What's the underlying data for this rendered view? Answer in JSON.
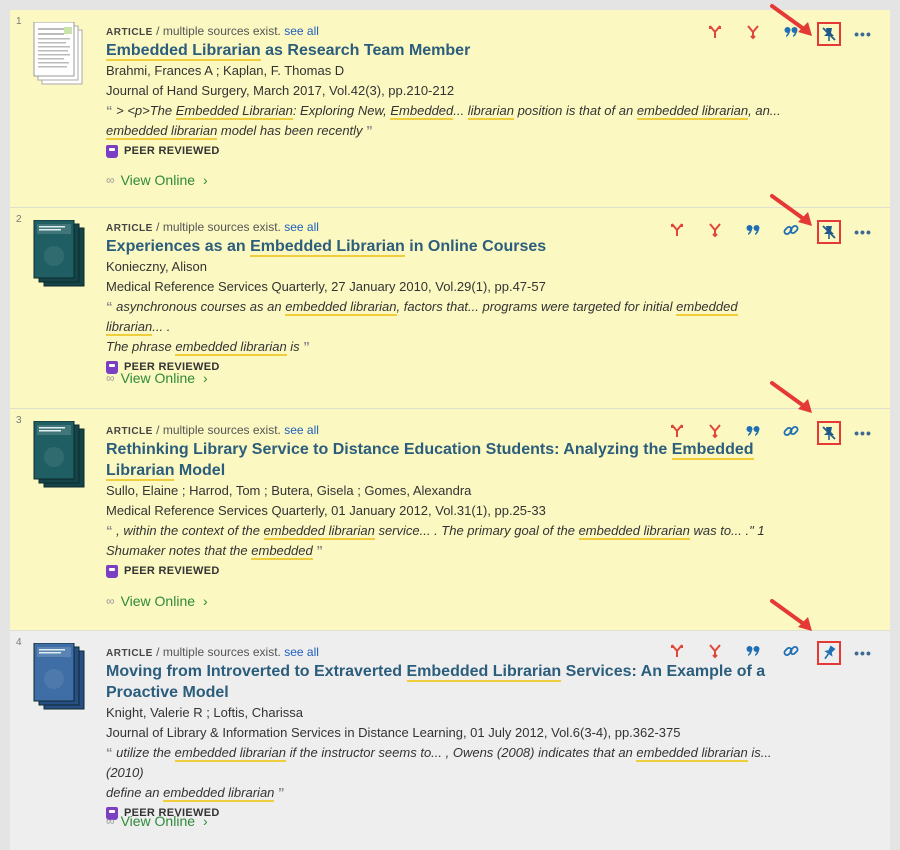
{
  "results": [
    {
      "number": "1",
      "type": "Article",
      "sources_text": " / multiple sources exist.",
      "see_all": "see all",
      "title_parts": [
        {
          "text": "Embedded Librarian",
          "hl": true
        },
        {
          "text": " as Research Team Member",
          "hl": false
        }
      ],
      "authors": "Brahmi, Frances A ; Kaplan, F. Thomas D",
      "source": "Journal of Hand Surgery, March 2017, Vol.42(3), pp.210-212",
      "snippet_lines": [
        [
          {
            "text": " > <p>The ",
            "hl": false
          },
          {
            "text": "Embedded Librarian",
            "hl": true
          },
          {
            "text": ": Exploring New, ",
            "hl": false
          },
          {
            "text": "Embedded",
            "hl": true
          },
          {
            "text": "... ",
            "hl": false
          },
          {
            "text": "librarian",
            "hl": true
          },
          {
            "text": " position is that of an ",
            "hl": false
          },
          {
            "text": "embedded librarian",
            "hl": true
          },
          {
            "text": ", an...",
            "hl": false
          }
        ],
        [
          {
            "text": "embedded librarian",
            "hl": true
          },
          {
            "text": " model has been recently",
            "hl": false
          }
        ]
      ],
      "peer_reviewed": "PEER REVIEWED",
      "view_online": "View Online",
      "pinned": true,
      "actions": [
        "cite-sources",
        "cited-by",
        "citation"
      ],
      "thumb_style": "document"
    },
    {
      "number": "2",
      "type": "Article",
      "sources_text": " / multiple sources exist.",
      "see_all": "see all",
      "title_parts": [
        {
          "text": "Experiences as an ",
          "hl": false
        },
        {
          "text": "Embedded Librarian",
          "hl": true
        },
        {
          "text": " in Online Courses",
          "hl": false
        }
      ],
      "authors": "Konieczny, Alison",
      "source": "Medical Reference Services Quarterly, 27 January 2010, Vol.29(1), pp.47-57",
      "snippet_lines": [
        [
          {
            "text": " asynchronous courses as an ",
            "hl": false
          },
          {
            "text": "embedded librarian",
            "hl": true
          },
          {
            "text": ", factors that... programs were targeted for initial ",
            "hl": false
          },
          {
            "text": "embedded librarian",
            "hl": true
          },
          {
            "text": "... .",
            "hl": false
          }
        ],
        [
          {
            "text": "The phrase ",
            "hl": false
          },
          {
            "text": "embedded librarian",
            "hl": true
          },
          {
            "text": " is",
            "hl": false
          }
        ]
      ],
      "peer_reviewed": "PEER REVIEWED",
      "view_online": "View Online",
      "pinned": true,
      "actions": [
        "cite-sources",
        "cited-by",
        "citation",
        "permalink"
      ],
      "thumb_style": "journal-teal"
    },
    {
      "number": "3",
      "type": "Article",
      "sources_text": " / multiple sources exist.",
      "see_all": "see all",
      "title_parts": [
        {
          "text": "Rethinking Library Service to Distance Education Students: Analyzing the ",
          "hl": false
        },
        {
          "text": "Embedded Librarian",
          "hl": true
        },
        {
          "text": " Model",
          "hl": false
        }
      ],
      "authors": "Sullo, Elaine ; Harrod, Tom ; Butera, Gisela ; Gomes, Alexandra",
      "source": "Medical Reference Services Quarterly, 01 January 2012, Vol.31(1), pp.25-33",
      "snippet_lines": [
        [
          {
            "text": " , within the context of the ",
            "hl": false
          },
          {
            "text": "embedded librarian",
            "hl": true
          },
          {
            "text": " service... . The primary goal of the ",
            "hl": false
          },
          {
            "text": "embedded librarian",
            "hl": true
          },
          {
            "text": " was to... .\" 1",
            "hl": false
          }
        ],
        [
          {
            "text": "Shumaker notes that the ",
            "hl": false
          },
          {
            "text": "embedded",
            "hl": true
          }
        ]
      ],
      "peer_reviewed": "PEER REVIEWED",
      "view_online": "View Online",
      "pinned": true,
      "actions": [
        "cite-sources",
        "cited-by",
        "citation",
        "permalink"
      ],
      "thumb_style": "journal-teal"
    },
    {
      "number": "4",
      "type": "Article",
      "sources_text": " / multiple sources exist.",
      "see_all": "see all",
      "title_parts": [
        {
          "text": "Moving from Introverted to Extraverted ",
          "hl": false
        },
        {
          "text": "Embedded Librarian",
          "hl": true
        },
        {
          "text": " Services: An Example of a Proactive Model",
          "hl": false
        }
      ],
      "authors": "Knight, Valerie R ; Loftis, Charissa",
      "source": "Journal of Library & Information Services in Distance Learning, 01 July 2012, Vol.6(3-4), pp.362-375",
      "snippet_lines": [
        [
          {
            "text": " utilize the ",
            "hl": false
          },
          {
            "text": "embedded librarian",
            "hl": true
          },
          {
            "text": " if the instructor seems to... , Owens (2008) indicates that an ",
            "hl": false
          },
          {
            "text": "embedded librarian",
            "hl": true
          },
          {
            "text": " is... (2010)",
            "hl": false
          }
        ],
        [
          {
            "text": "define an ",
            "hl": false
          },
          {
            "text": "embedded librarian",
            "hl": true
          }
        ]
      ],
      "peer_reviewed": "PEER REVIEWED",
      "view_online": "View Online",
      "pinned": false,
      "actions": [
        "cite-sources",
        "cited-by",
        "citation",
        "permalink"
      ],
      "thumb_style": "journal-blue"
    }
  ],
  "colors": {
    "pinned_bg": "#fbf8c2",
    "unpinned_bg": "#eeeeee",
    "highlight": "#f0cd3c",
    "annotation_red": "#e53935",
    "title_blue": "#2b5d7c",
    "view_green": "#2e8a3a"
  },
  "icons": {
    "cite-sources": "cite-sources-icon",
    "cited-by": "cited-by-icon",
    "citation": "citation-icon",
    "permalink": "permalink-icon",
    "pin": "pin-icon",
    "more": "more-icon"
  },
  "more_label": "•••"
}
